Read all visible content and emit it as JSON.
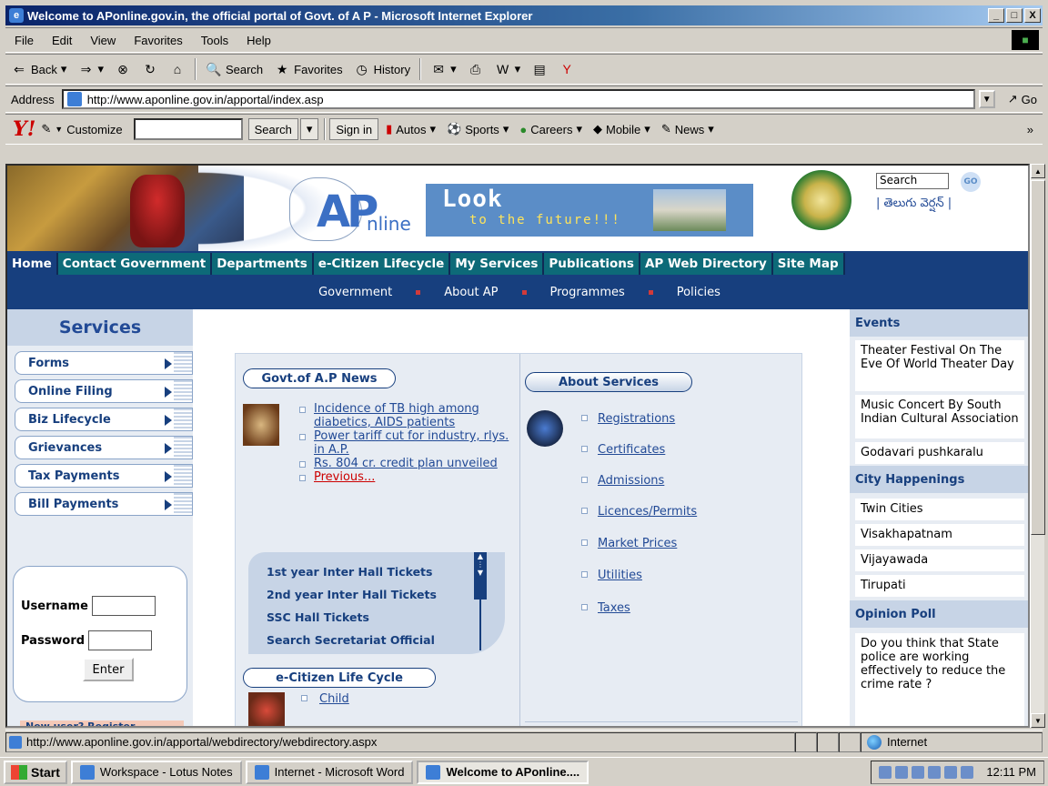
{
  "window": {
    "title": "Welcome to APonline.gov.in, the official portal of Govt. of A P - Microsoft Internet Explorer",
    "min": "_",
    "max": "□",
    "close": "X"
  },
  "menu": {
    "items": [
      "File",
      "Edit",
      "View",
      "Favorites",
      "Tools",
      "Help"
    ]
  },
  "toolbar": {
    "back": "Back",
    "search": "Search",
    "favorites": "Favorites",
    "history": "History"
  },
  "address": {
    "label": "Address",
    "url": "http://www.aponline.gov.in/apportal/index.asp",
    "go": "Go"
  },
  "yahoo": {
    "logo": "Y!",
    "customize": "Customize",
    "search": "Search",
    "signin": "Sign in",
    "links": [
      "Autos",
      "Sports",
      "Careers",
      "Mobile",
      "News"
    ],
    "more": "»"
  },
  "banner": {
    "look": "Look",
    "future": "to the future!!!",
    "online": "nline",
    "ap": "AP",
    "search_placeholder": "Search",
    "go": "GO",
    "telugu": "| తెలుగు వెర్షన్ |"
  },
  "nav": {
    "tabs": [
      "Home",
      "Contact Government",
      "Departments",
      "e-Citizen Lifecycle",
      "My Services",
      "Publications",
      "AP Web Directory",
      "Site Map"
    ]
  },
  "subnav": {
    "items": [
      "Government",
      "About AP",
      "Programmes",
      "Policies"
    ]
  },
  "services": {
    "heading": "Services",
    "items": [
      "Forms",
      "Online Filing",
      "Biz Lifecycle",
      "Grievances",
      "Tax Payments",
      "Bill Payments"
    ]
  },
  "login": {
    "username_label": "Username",
    "password_label": "Password",
    "enter": "Enter",
    "newuser": "New user? Register"
  },
  "news": {
    "heading": "Govt.of A.P News",
    "items": [
      "Incidence of TB high among diabetics, AIDS patients",
      "Power tariff cut for industry, rlys. in A.P.",
      "Rs. 804 cr. credit plan unveiled"
    ],
    "previous": "Previous..."
  },
  "hall": {
    "items": [
      "1st year Inter Hall Tickets",
      "2nd year Inter Hall Tickets",
      "SSC Hall Tickets",
      "Search Secretariat Official"
    ]
  },
  "about": {
    "heading": "About Services",
    "items": [
      "Registrations",
      "Certificates",
      "Admissions",
      "Licences/Permits",
      "Market Prices",
      "Utilities",
      "Taxes"
    ]
  },
  "ecitizen": {
    "heading": "e-Citizen Life Cycle",
    "child": "Child"
  },
  "right": {
    "events_heading": "Events",
    "events": [
      "Theater Festival On The Eve Of World Theater Day",
      "Music Concert By South Indian Cultural Association",
      "Godavari pushkaralu"
    ],
    "city_heading": "City Happenings",
    "cities": [
      "Twin Cities",
      "Visakhapatnam",
      "Vijayawada",
      "Tirupati"
    ],
    "poll_heading": "Opinion Poll",
    "poll_text": "Do you think that State police are working effectively to reduce the crime rate ?"
  },
  "status": {
    "url": "http://www.aponline.gov.in/apportal/webdirectory/webdirectory.aspx",
    "zone": "Internet"
  },
  "taskbar": {
    "start": "Start",
    "tasks": [
      "Workspace - Lotus Notes",
      "Internet - Microsoft Word",
      "Welcome to APonline...."
    ],
    "clock": "12:11 PM"
  }
}
